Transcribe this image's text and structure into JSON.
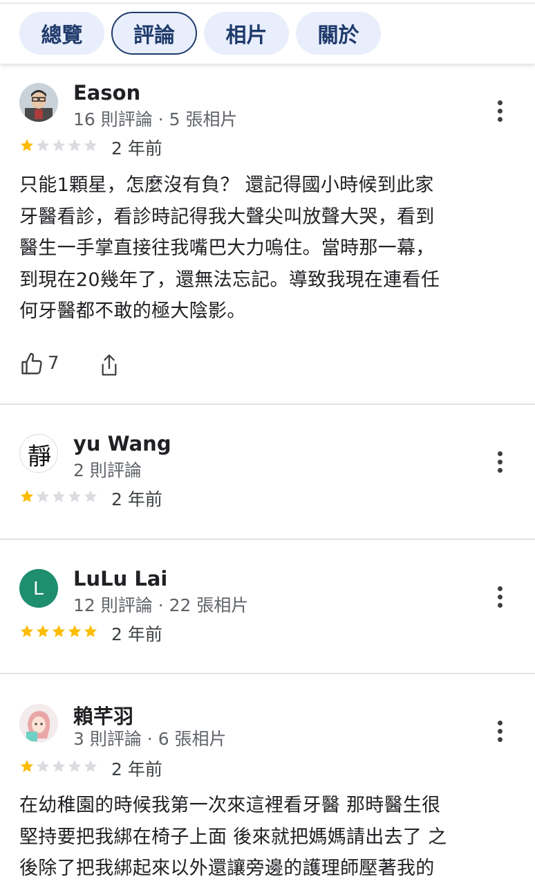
{
  "tabs": [
    {
      "label": "總覽",
      "active": false
    },
    {
      "label": "評論",
      "active": true
    },
    {
      "label": "相片",
      "active": false
    },
    {
      "label": "關於",
      "active": false
    }
  ],
  "reviews": [
    {
      "name": "Eason",
      "meta": "16 則評論 · 5 張相片",
      "rating": 1,
      "time": "2 年前",
      "text": "只能1顆星，怎麼沒有負？ 還記得國小時候到此家牙醫看診，看診時記得我大聲尖叫放聲大哭，看到醫生一手掌直接往我嘴巴大力嗚住。當時那一幕，到現在20幾年了，還無法忘記。導致我現在連看任何牙醫都不敢的極大陰影。",
      "text_lines": [
        "只能1顆星，怎麼沒有負？ 還記得國小時候到此家",
        "牙醫看診，看診時記得我大聲尖叫放聲大哭，看到",
        "醫生一手掌直接往我嘴巴大力嗚住。當時那一幕，",
        "到現在20幾年了，還無法忘記。導致我現在連看任",
        "何牙醫都不敢的極大陰影。"
      ],
      "likes": "7",
      "avatar_icon": "person-photo-avatar"
    },
    {
      "name": "yu Wang",
      "meta": "2 則評論",
      "rating": 1,
      "time": "2 年前",
      "avatar_icon": "calligraphy-avatar",
      "avatar_glyph": "靜"
    },
    {
      "name": "LuLu Lai",
      "meta": "12 則評論 · 22 張相片",
      "rating": 5,
      "time": "2 年前",
      "avatar_letter": "L",
      "avatar_color": "#1e8e6e"
    },
    {
      "name": "賴芊羽",
      "meta": "3 則評論 · 6 張相片",
      "rating": 1,
      "time": "2 年前",
      "avatar_icon": "anime-girl-avatar",
      "text_lines": [
        "在幼稚園的時候我第一次來這裡看牙醫 那時醫生很",
        "堅持要把我綁在椅子上面 後來就把媽媽請出去了 之",
        "後除了把我綁起來以外還讓旁邊的護理師壓著我的"
      ]
    }
  ],
  "colors": {
    "star_filled": "#fbbc04",
    "star_empty": "#dadce0",
    "tab_bg": "#e8eefb",
    "tab_text": "#1f3a6b"
  }
}
